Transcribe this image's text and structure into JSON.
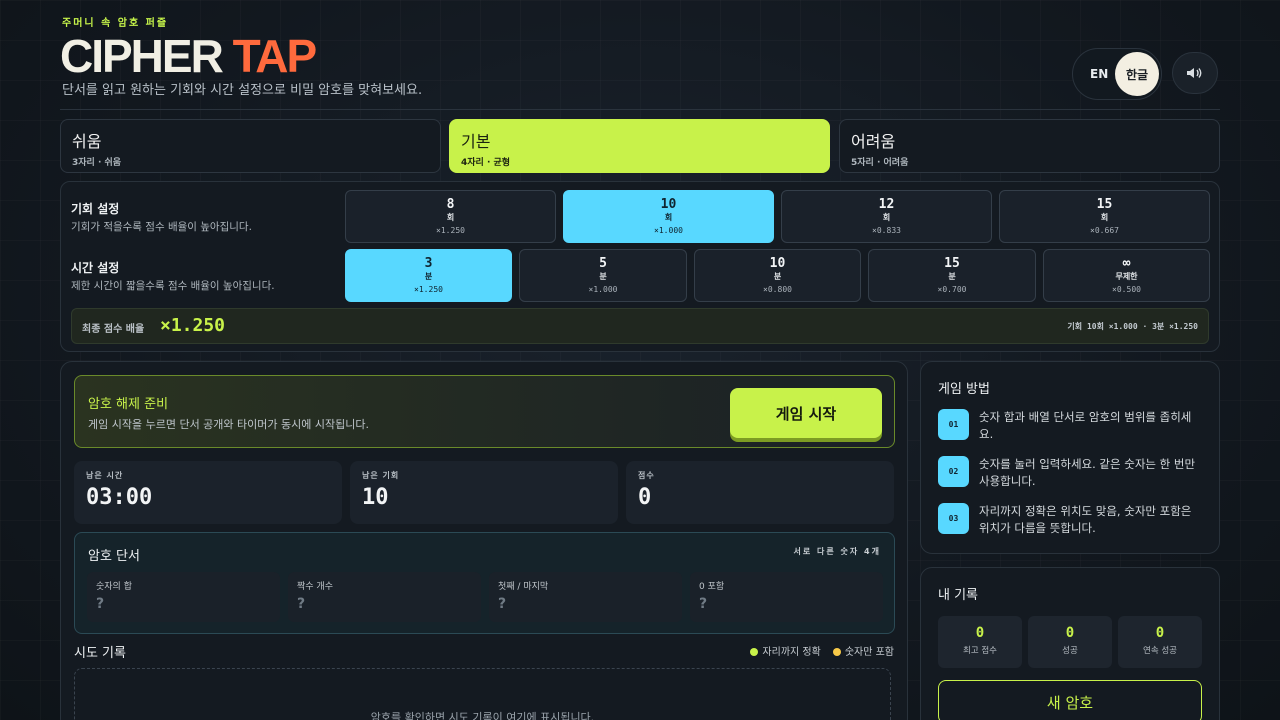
{
  "header": {
    "kicker": "주머니 속 암호 퍼즐",
    "title_part1": "CIPHER",
    "title_part2": "TAP",
    "subtitle": "단서를 읽고 원하는 기회와 시간 설정으로 비밀 암호를 맞혀보세요.",
    "lang_en": "EN",
    "lang_ko": "한글",
    "sound_icon": "speaker-icon"
  },
  "difficulty": [
    {
      "title": "쉬움",
      "sub": "3자리 · 쉬움",
      "active": false
    },
    {
      "title": "기본",
      "sub": "4자리 · 균형",
      "active": true
    },
    {
      "title": "어려움",
      "sub": "5자리 · 어려움",
      "active": false
    }
  ],
  "settings": {
    "chances": {
      "title": "기회 설정",
      "desc": "기회가 적을수록 점수 배율이 높아집니다.",
      "options": [
        {
          "value": "8",
          "unit": "회",
          "mult": "×1.250",
          "active": false
        },
        {
          "value": "10",
          "unit": "회",
          "mult": "×1.000",
          "active": true
        },
        {
          "value": "12",
          "unit": "회",
          "mult": "×0.833",
          "active": false
        },
        {
          "value": "15",
          "unit": "회",
          "mult": "×0.667",
          "active": false
        }
      ]
    },
    "time": {
      "title": "시간 설정",
      "desc": "제한 시간이 짧을수록 점수 배율이 높아집니다.",
      "options": [
        {
          "value": "3",
          "unit": "분",
          "mult": "×1.250",
          "active": true
        },
        {
          "value": "5",
          "unit": "분",
          "mult": "×1.000",
          "active": false
        },
        {
          "value": "10",
          "unit": "분",
          "mult": "×0.800",
          "active": false
        },
        {
          "value": "15",
          "unit": "분",
          "mult": "×0.700",
          "active": false
        },
        {
          "value": "∞",
          "unit": "무제한",
          "mult": "×0.500",
          "active": false
        }
      ]
    },
    "final_label": "최종 점수 배율",
    "final_value": "×1.250",
    "final_summary": "기회 10회 ×1.000 · 3분 ×1.250"
  },
  "main": {
    "ready_title": "암호 해제 준비",
    "ready_desc": "게임 시작을 누르면 단서 공개와 타이머가 동시에 시작됩니다.",
    "start_label": "게임 시작",
    "stats": [
      {
        "label": "남은 시간",
        "value": "03:00"
      },
      {
        "label": "남은 기회",
        "value": "10"
      },
      {
        "label": "점수",
        "value": "0"
      }
    ],
    "clues_title": "암호 단서",
    "clues_note": "서로 다른 숫자 4개",
    "clues": [
      {
        "label": "숫자의 합",
        "value": "?"
      },
      {
        "label": "짝수 개수",
        "value": "?"
      },
      {
        "label": "첫째 / 마지막",
        "value": "?"
      },
      {
        "label": "0 포함",
        "value": "?"
      }
    ],
    "history_title": "시도 기록",
    "legend_exact": "자리까지 정확",
    "legend_partial": "숫자만 포함",
    "history_empty": "암호를 확인하면 시도 기록이 여기에 표시됩니다.",
    "colors": {
      "exact": "#c8f24a",
      "partial": "#f7c948"
    }
  },
  "how": {
    "title": "게임 방법",
    "steps": [
      {
        "num": "01",
        "text": "숫자 합과 배열 단서로 암호의 범위를 좁히세요."
      },
      {
        "num": "02",
        "text": "숫자를 눌러 입력하세요. 같은 숫자는 한 번만 사용합니다."
      },
      {
        "num": "03",
        "text": "자리까지 정확은 위치도 맞음, 숫자만 포함은 위치가 다름을 뜻합니다."
      }
    ]
  },
  "records": {
    "title": "내 기록",
    "items": [
      {
        "value": "0",
        "label": "최고 점수"
      },
      {
        "value": "0",
        "label": "성공"
      },
      {
        "value": "0",
        "label": "연속 성공"
      }
    ],
    "new_label": "새 암호"
  },
  "accent": "#c8f24a",
  "accent2": "#58d8ff",
  "brand": "#ff6a3d"
}
